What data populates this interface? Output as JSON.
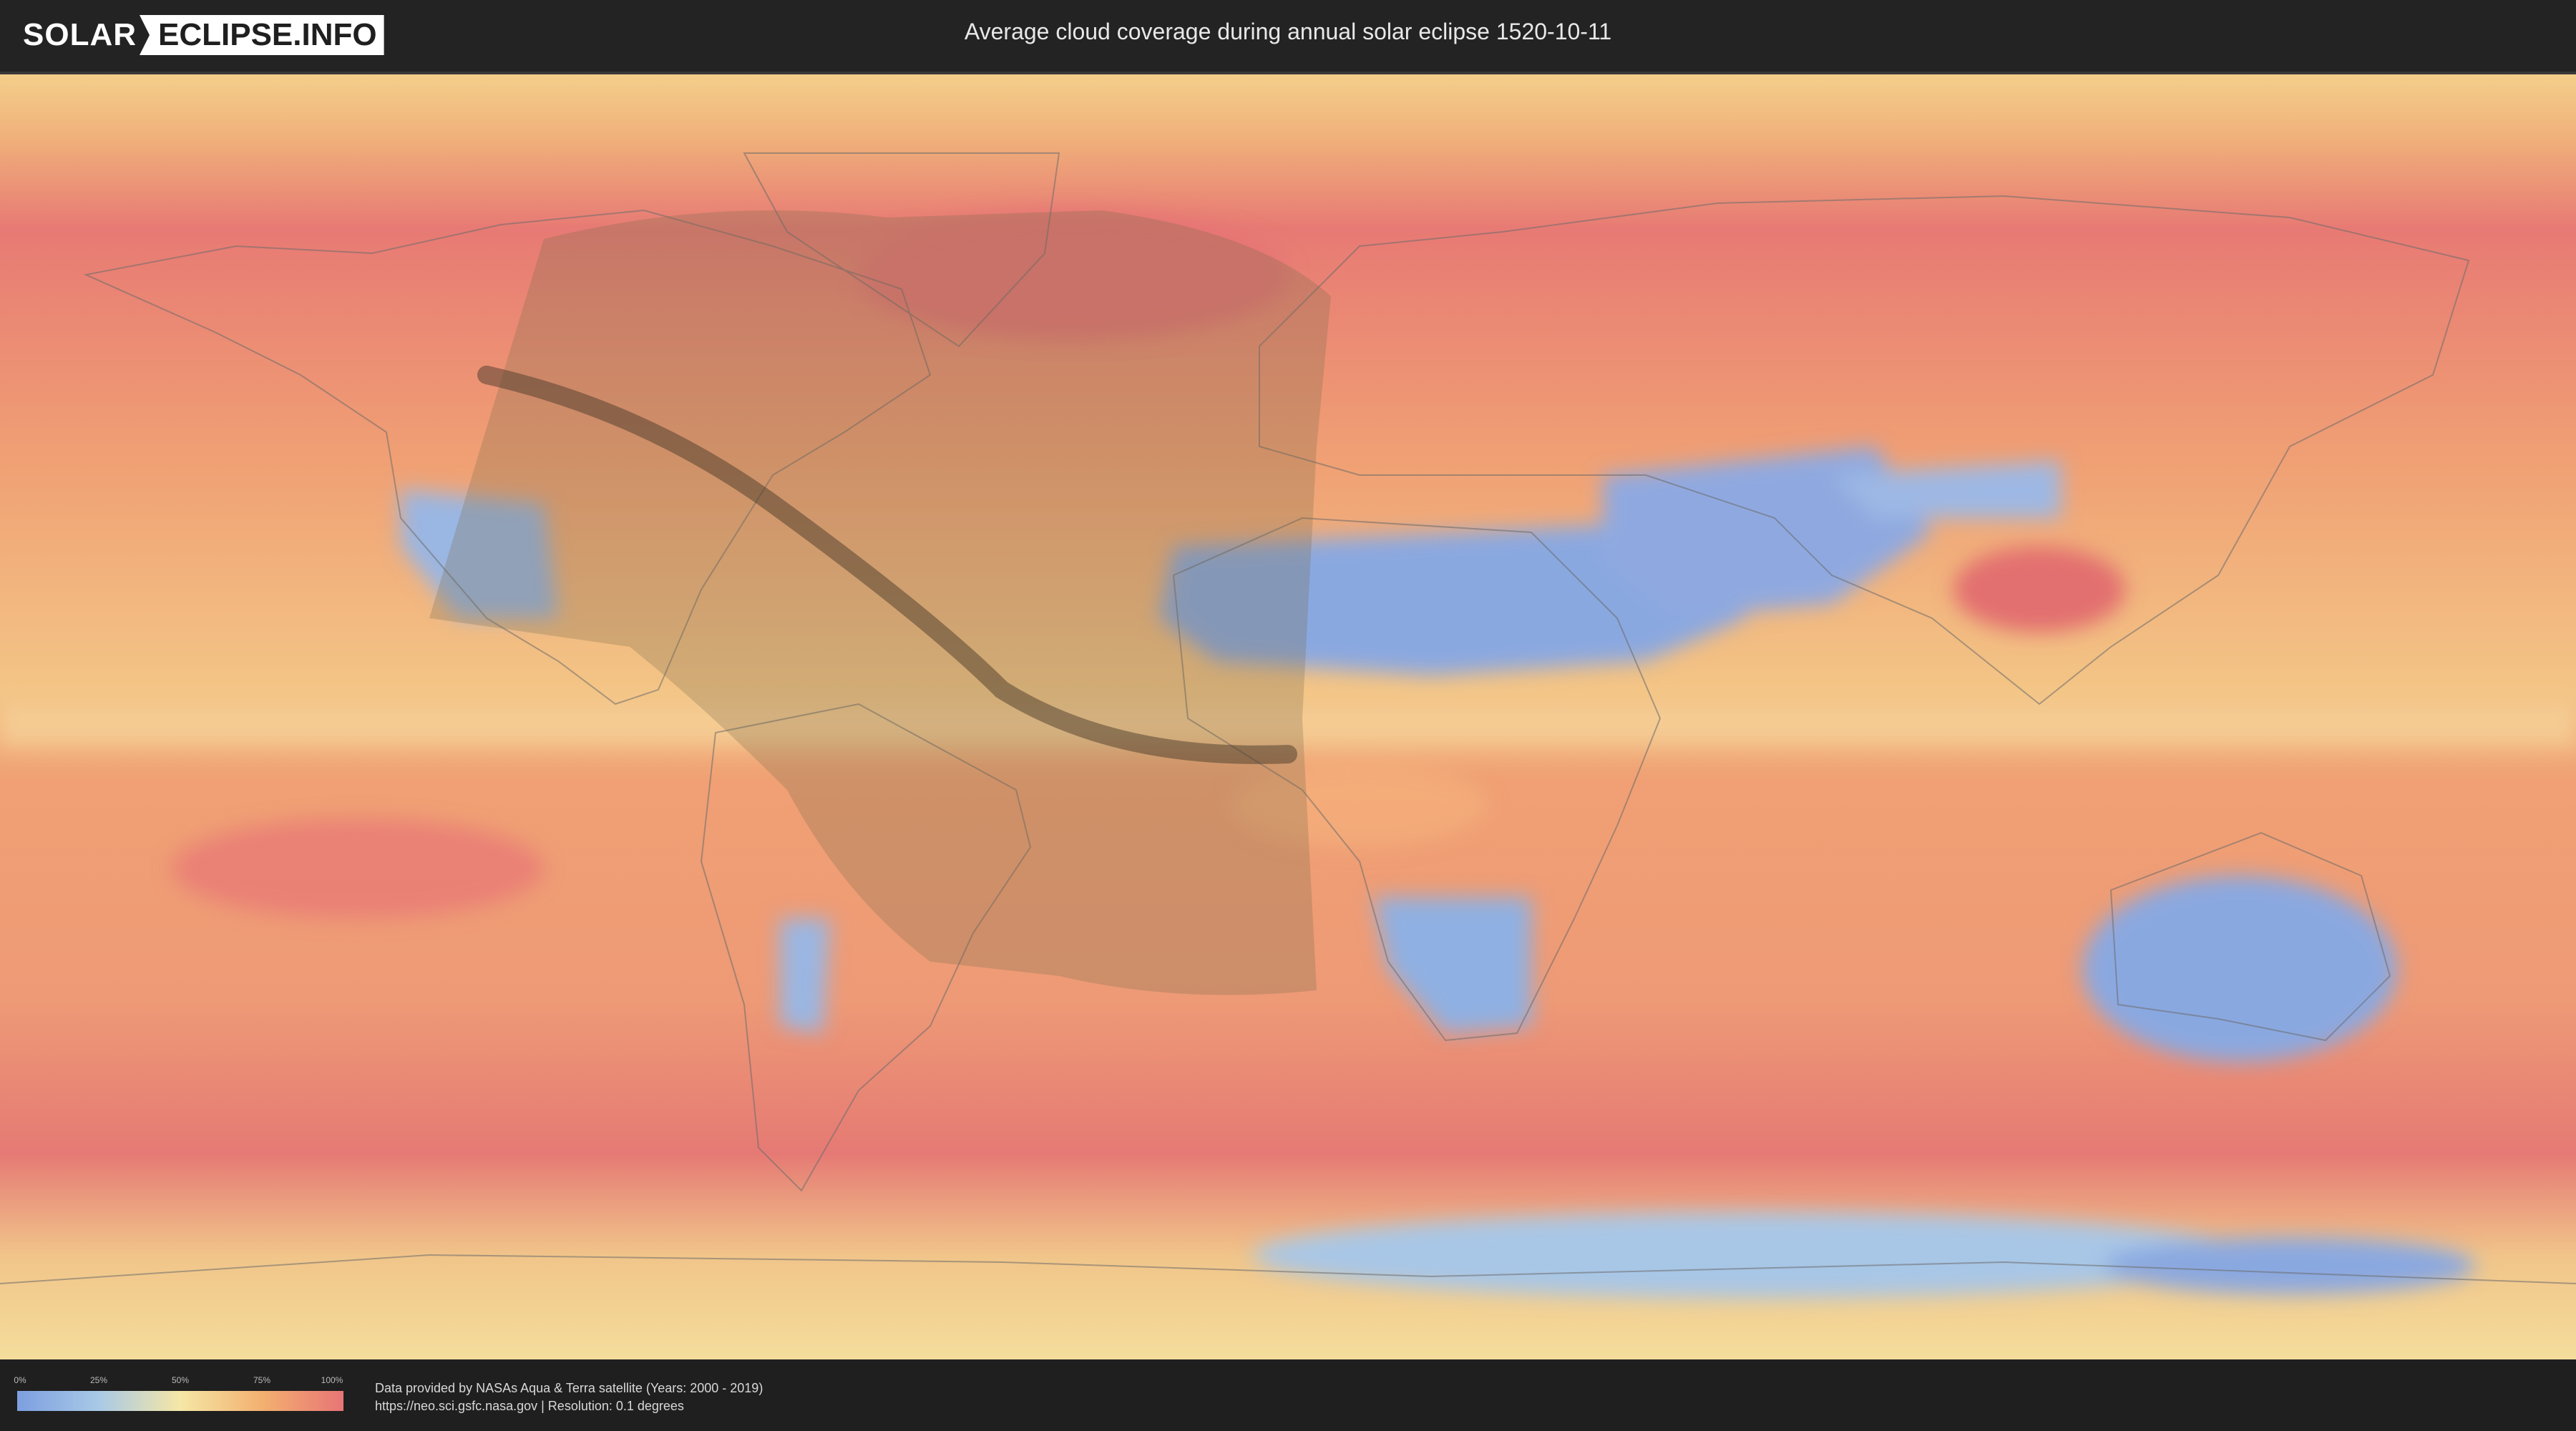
{
  "header": {
    "logo_left": "SOLAR",
    "logo_right": "ECLIPSE.INFO",
    "title": "Average cloud coverage during annual solar eclipse 1520-10-11"
  },
  "legend": {
    "ticks": [
      "0%",
      "25%",
      "50%",
      "75%",
      "100%"
    ],
    "colors": [
      "#7c9fe0",
      "#a9c9e6",
      "#f5e7a6",
      "#f3b070",
      "#e87575"
    ]
  },
  "footer": {
    "credit_line1": "Data provided by NASAs Aqua & Terra satellite (Years: 2000 - 2019)",
    "credit_line2": "https://neo.sci.gsfc.nasa.gov | Resolution: 0.1 degrees"
  },
  "map": {
    "ocean_color": "#f0a074",
    "cloudy_color": "#e57a74",
    "clear_color": "#8aa8e0",
    "eclipse_visibility_color": "#7a6a4a",
    "eclipse_path_color": "#4a3a2a"
  }
}
